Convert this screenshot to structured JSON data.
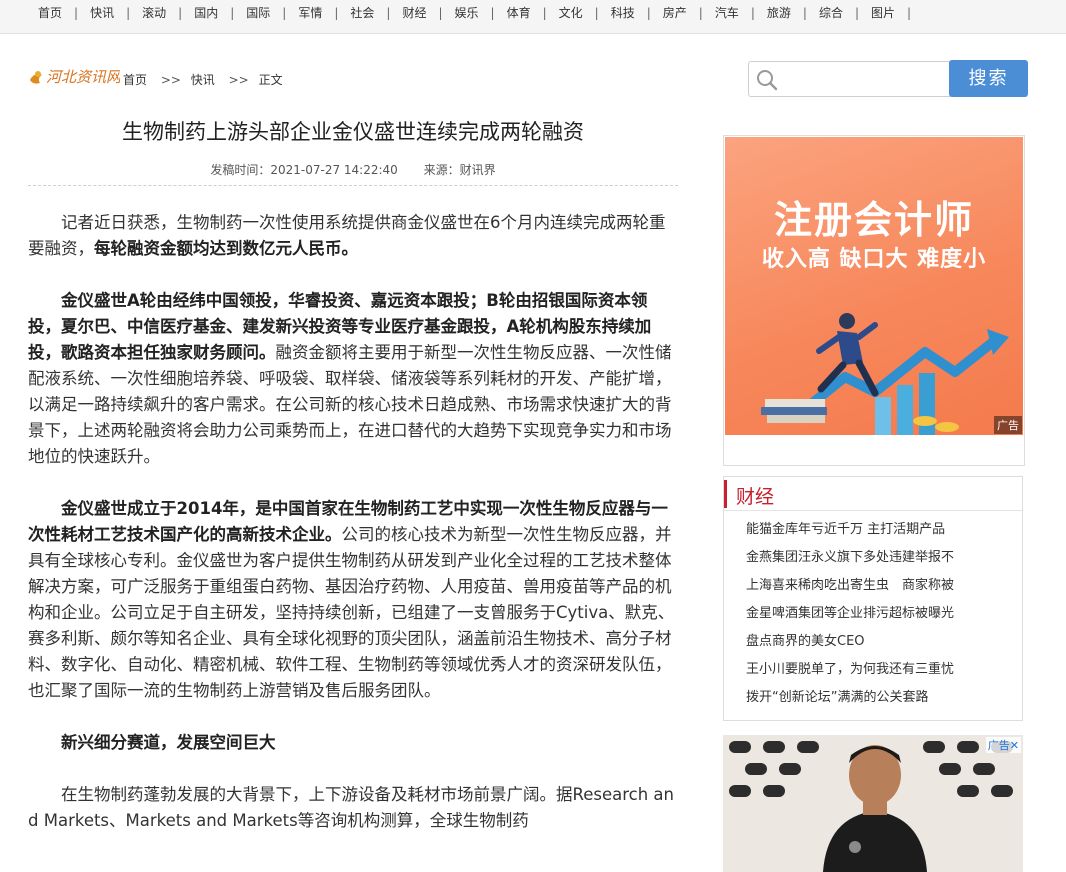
{
  "topnav": {
    "items": [
      "首页",
      "快讯",
      "滚动",
      "国内",
      "国际",
      "军情",
      "社会",
      "财经",
      "娱乐",
      "体育",
      "文化",
      "科技",
      "房产",
      "汽车",
      "旅游",
      "综合",
      "图片"
    ],
    "separator": "|"
  },
  "header": {
    "logo_text": "河北资讯网",
    "breadcrumb": [
      "首页",
      "快讯",
      "正文"
    ],
    "breadcrumb_sep": ">>"
  },
  "search": {
    "placeholder": "",
    "button_label": "搜索"
  },
  "article": {
    "title": "生物制药上游头部企业金仪盛世连续完成两轮融资",
    "publish_label": "发稿时间：",
    "publish_time": "2021-07-27 14:22:40",
    "source_label": "来源：",
    "source": "财讯界",
    "p1_a": "记者近日获悉，生物制药一次性使用系统提供商金仪盛世在6个月内连续完成两轮重要融资，",
    "p1_b": "每轮融资金额均达到数亿元人民币。",
    "p2_a": "金仪盛世A轮由经纬中国领投，华睿投资、嘉远资本跟投；B轮由招银国际资本领投，夏尔巴、中信医疗基金、建发新兴投资等专业医疗基金跟投，A轮机构股东持续加投，歌路资本担任独家财务顾问。",
    "p2_b": "融资金额将主要用于新型一次性生物反应器、一次性储配液系统、一次性细胞培养袋、呼吸袋、取样袋、储液袋等系列耗材的开发、产能扩增，以满足一路持续飙升的客户需求。在公司新的核心技术日趋成熟、市场需求快速扩大的背景下，上述两轮融资将会助力公司乘势而上，在进口替代的大趋势下实现竞争实力和市场地位的快速跃升。",
    "p3_a": "金仪盛世成立于2014年，是中国首家在生物制药工艺中实现一次性生物反应器与一次性耗材工艺技术国产化的高新技术企业。",
    "p3_b": "公司的核心技术为新型一次性生物反应器，并具有全球核心专利。金仪盛世为客户提供生物制药从研发到产业化全过程的工艺技术整体解决方案，可广泛服务于重组蛋白药物、基因治疗药物、人用疫苗、兽用疫苗等产品的机构和企业。公司立足于自主研发，坚持持续创新，已组建了一支曾服务于Cytiva、默克、赛多利斯、颇尔等知名企业、具有全球化视野的顶尖团队，涵盖前沿生物技术、高分子材料、数字化、自动化、精密机械、软件工程、生物制药等领域优秀人才的资深研发队伍，也汇聚了国际一流的生物制药上游营销及售后服务团队。",
    "p4": "新兴细分赛道，发展空间巨大",
    "p5": "在生物制药蓬勃发展的大背景下，上下游设备及耗材市场前景广阔。据Research and Markets、Markets and Markets等咨询机构测算，全球生物制药"
  },
  "ad1": {
    "title": "注册会计师",
    "subtitle": "收入高  缺口大  难度小",
    "badge": "广告"
  },
  "sidebar_news": {
    "heading": "财经",
    "items": [
      "能猫金库年亏近千万 主打活期产品",
      "金燕集团汪永义旗下多处违建举报不",
      "上海喜来稀肉吃出寄生虫　商家称被",
      "金星啤酒集团等企业排污超标被曝光",
      "盘点商界的美女CEO",
      "王小川要脱单了，为何我还有三重忧",
      "拨开“创新论坛”满满的公关套路"
    ]
  },
  "ad2": {
    "badge": "广告✕"
  },
  "colors": {
    "accent_blue": "#4b8ed6",
    "section_red": "#c8202f",
    "ad_orange": "#f7885c"
  }
}
